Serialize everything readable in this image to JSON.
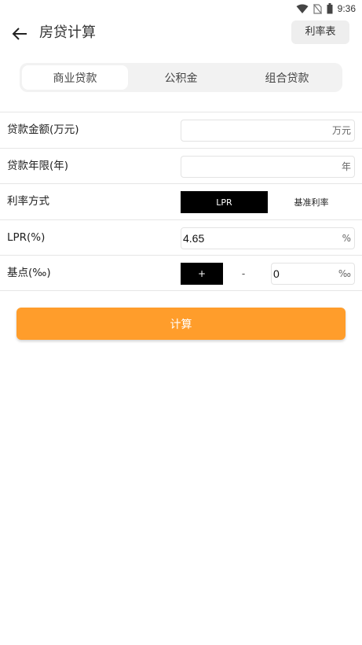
{
  "status_bar": {
    "time": "9:36",
    "icons": [
      "wifi-icon",
      "no-sim-icon",
      "battery-icon"
    ]
  },
  "header": {
    "title": "房贷计算",
    "rate_table_button": "利率表",
    "back_icon": "arrow-left-icon"
  },
  "tabs": [
    {
      "label": "商业贷款",
      "active": true
    },
    {
      "label": "公积金",
      "active": false
    },
    {
      "label": "组合贷款",
      "active": false
    }
  ],
  "form": {
    "amount": {
      "label": "贷款金额(万元)",
      "value": "",
      "unit": "万元"
    },
    "years": {
      "label": "贷款年限(年)",
      "value": "",
      "unit": "年"
    },
    "rate_mode": {
      "label": "利率方式",
      "options": [
        "LPR",
        "基准利率"
      ],
      "selected": "LPR"
    },
    "lpr": {
      "label": "LPR(%)",
      "value": "4.65",
      "unit": "%"
    },
    "basis_points": {
      "label": "基点(‰)",
      "plus": "+",
      "minus": "-",
      "value": "0",
      "unit": "‰"
    }
  },
  "calculate_button": "计算",
  "colors": {
    "accent": "#ff9d2b",
    "selected_toggle": "#000000",
    "tab_bg": "#f2f2f2",
    "divider": "#e6e6e6"
  }
}
